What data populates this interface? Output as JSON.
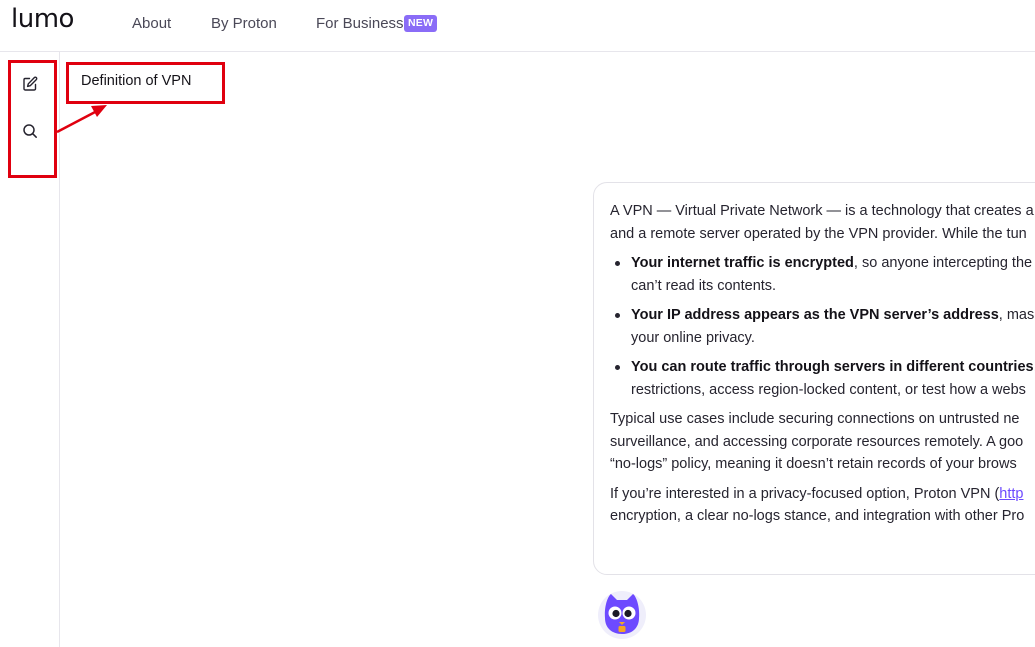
{
  "header": {
    "logo": "lumo",
    "nav": {
      "about": "About",
      "by_proton": "By Proton",
      "for_business": "For Business",
      "new_badge": "NEW"
    }
  },
  "sidebar": {
    "new_chat_icon": "edit-icon",
    "search_icon": "search-icon"
  },
  "chat": {
    "title": "Definition of VPN"
  },
  "message": {
    "p1_line1": "A VPN — Virtual Private Network — is a technology that creates a",
    "p1_line2": "and a remote server operated by the VPN provider. While the tun",
    "b1_bold": "Your internet traffic is encrypted",
    "b1_rest": ", so anyone intercepting the",
    "b1_line2": "can’t read its contents.",
    "b2_bold": "Your IP address appears as the VPN server’s address",
    "b2_rest": ", mask",
    "b2_line2": "your online privacy.",
    "b3_bold": "You can route traffic through servers in different countries",
    "b3_rest": ",",
    "b3_line2": "restrictions, access region‑locked content, or test how a webs",
    "p2_line1": "Typical use cases include securing connections on untrusted ne",
    "p2_line2": "surveillance, and accessing corporate resources remotely. A goo",
    "p2_line3": "“no‑logs” policy, meaning it doesn’t retain records of your brows",
    "p3_line1_start": "If you’re interested in a privacy‑focused option, Proton VPN (",
    "p3_link": "http",
    "p3_line2": "encryption, a clear no‑logs stance, and integration with other Pro"
  },
  "colors": {
    "accent": "#6d4aff",
    "badge": "#8a6cf7",
    "annotation": "#e0000f",
    "mascot": "#6d4aff"
  }
}
